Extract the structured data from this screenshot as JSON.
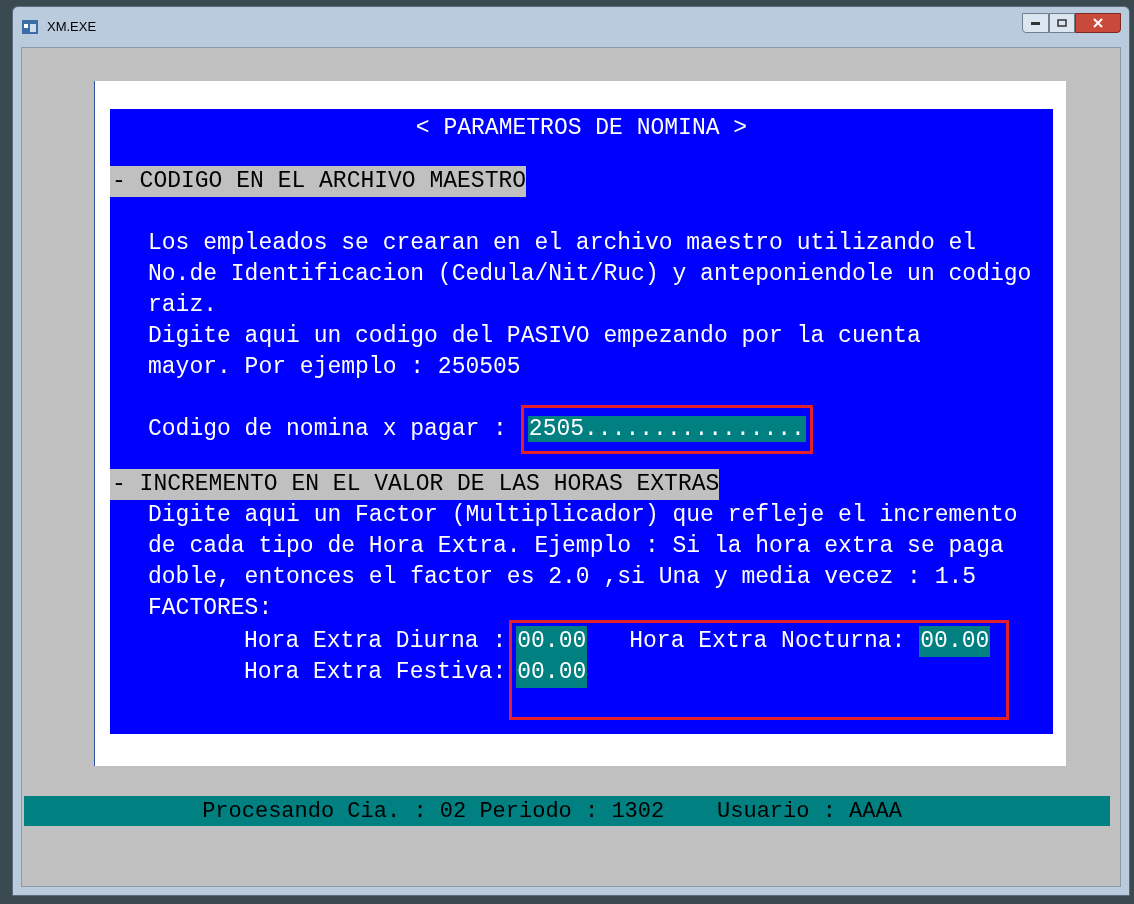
{
  "window": {
    "title": "XM.EXE"
  },
  "screen": {
    "title": "< PARAMETROS DE NOMINA >",
    "master_code": {
      "heading": "- CODIGO EN EL ARCHIVO MAESTRO",
      "text": "Los empleados se crearan en el archivo maestro utilizando el\nNo.de Identificacion (Cedula/Nit/Ruc) y anteponiendole un codigo\nraiz.\nDigite aqui un codigo del PASIVO empezando por la cuenta\nmayor. Por ejemplo : 250505",
      "field": {
        "label": "Codigo de nomina x pagar :",
        "value": "2505................",
        "highlighted": true
      }
    },
    "overtime": {
      "heading": "- INCREMENTO EN EL VALOR DE LAS HORAS EXTRAS",
      "text": "Digite aqui un Factor (Multiplicador) que refleje el incremento\nde cada tipo de Hora Extra. Ejemplo : Si la hora extra se paga\ndoble, entonces el factor es 2.0 ,si Una y media vecez : 1.5",
      "factors_label": "FACTORES:",
      "highlighted": true,
      "factors": [
        {
          "label": "Hora Extra Diurna :",
          "value": "00.00"
        },
        {
          "label": "Hora Extra Nocturna:",
          "value": "00.00"
        },
        {
          "label": "Hora Extra Festiva:",
          "value": "00.00"
        }
      ]
    }
  },
  "status_bar": "Procesando Cia. : 02 Periodo : 1302    Usuario : AAAA"
}
